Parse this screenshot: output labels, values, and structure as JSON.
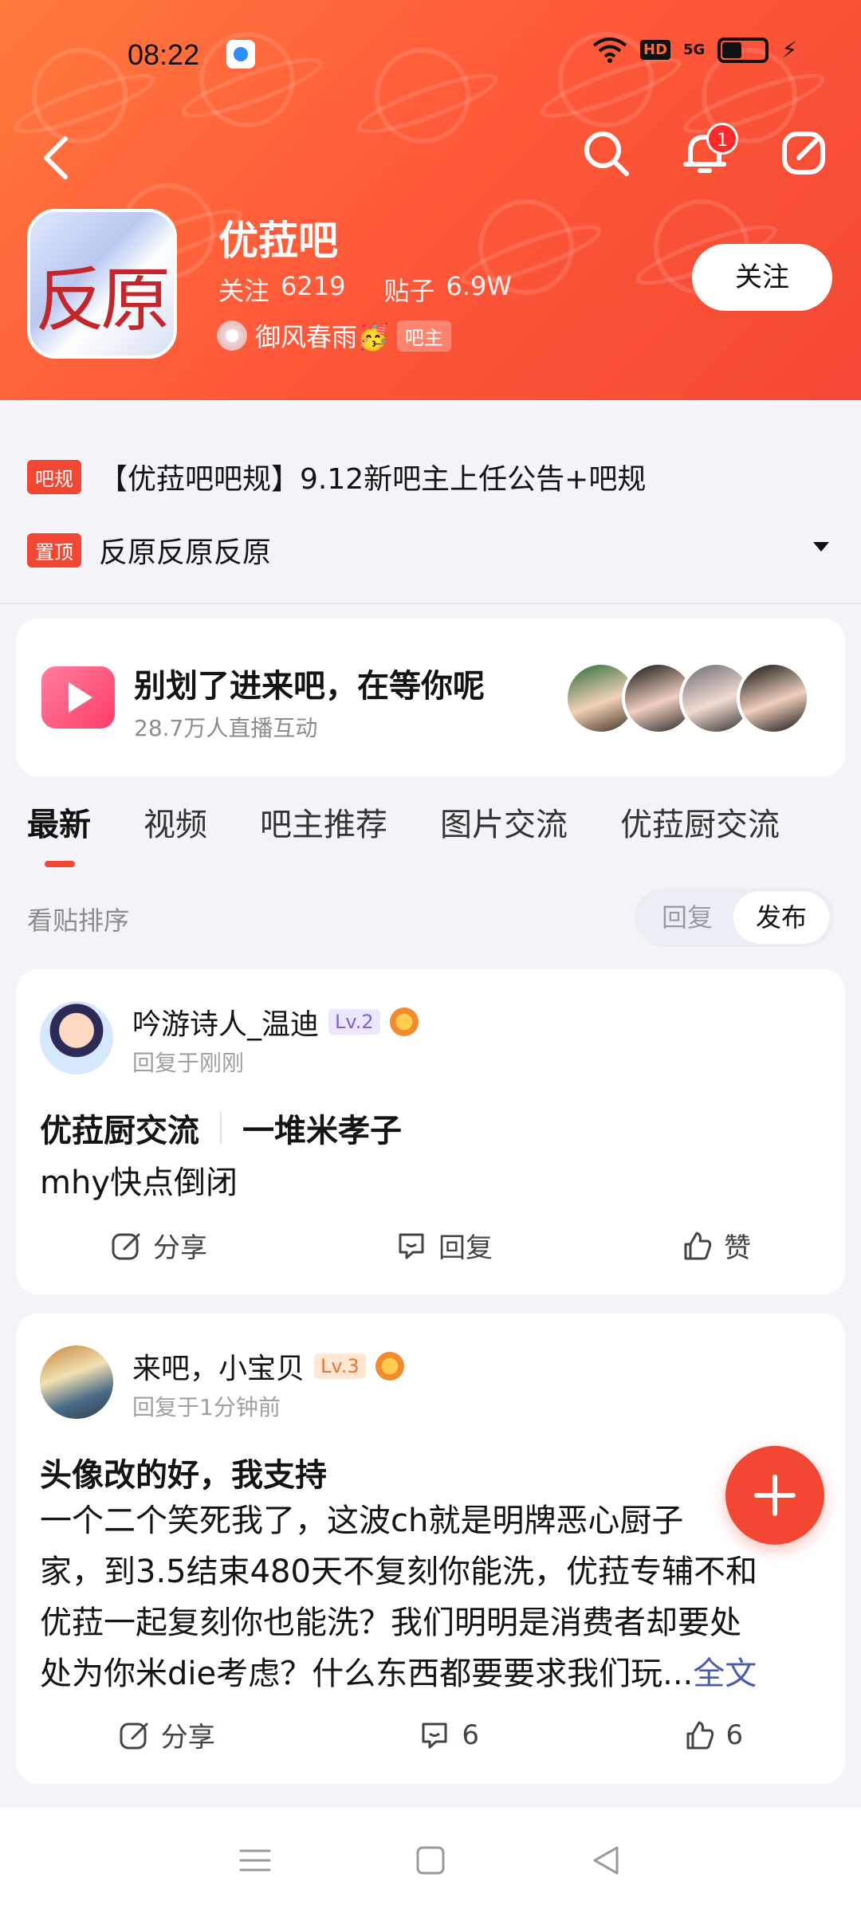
{
  "status_bar": {
    "time": "08:22",
    "network": "5G",
    "hd_label": "HD",
    "icons": [
      "wifi-icon",
      "hd-icon",
      "5g-signal-icon",
      "battery-icon",
      "charging-icon"
    ]
  },
  "header": {
    "back_icon": "back-arrow-icon",
    "search_icon": "search-icon",
    "bell_icon": "bell-icon",
    "bell_badge": "1",
    "edit_icon": "edit-icon",
    "forum_avatar_text": "反原",
    "forum_name": "优菈吧",
    "stats": {
      "follow_label": "关注",
      "follow_count": "6219",
      "posts_label": "贴子",
      "posts_count": "6.9W"
    },
    "owner": {
      "name": "御风春雨🥳",
      "badge": "吧主"
    },
    "follow_button": "关注"
  },
  "notices": [
    {
      "tag": "吧规",
      "text": "【优菈吧吧规】9.12新吧主上任公告+吧规"
    },
    {
      "tag": "置顶",
      "text": "反原反原反原"
    }
  ],
  "live_card": {
    "title": "别划了进来吧，在等你呢",
    "subtitle": "28.7万人直播互动"
  },
  "tabs": [
    "最新",
    "视频",
    "吧主推荐",
    "图片交流",
    "优菈厨交流"
  ],
  "sort": {
    "label": "看贴排序",
    "reply": "回复",
    "publish": "发布"
  },
  "posts": [
    {
      "author": "吟游诗人_温迪",
      "level": "Lv.2",
      "reply_time": "回复于刚刚",
      "category": "优菈厨交流",
      "title": "一堆米孝子",
      "body": "mhy快点倒闭",
      "share": "分享",
      "reply": "回复",
      "like": "赞"
    },
    {
      "author": "来吧，小宝贝",
      "level": "Lv.3",
      "reply_time": "回复于1分钟前",
      "title": "头像改的好，我支持",
      "body_lines": [
        "一个二个笑死我了，这波ch就是明牌恶心厨子",
        "家，到3.5结束480天不复刻你能洗，优菈专辅不和",
        "优菈一起复刻你也能洗？我们明明是消费者却要处",
        "处为你米die考虑？什么东西都要要求我们玩..."
      ],
      "more": "全文",
      "share": "分享",
      "reply_count": "6",
      "like_count": "6"
    }
  ],
  "colors": {
    "brand": "#f24733",
    "header_gradient_start": "#ff7a3d",
    "link": "#4c5ea8"
  }
}
